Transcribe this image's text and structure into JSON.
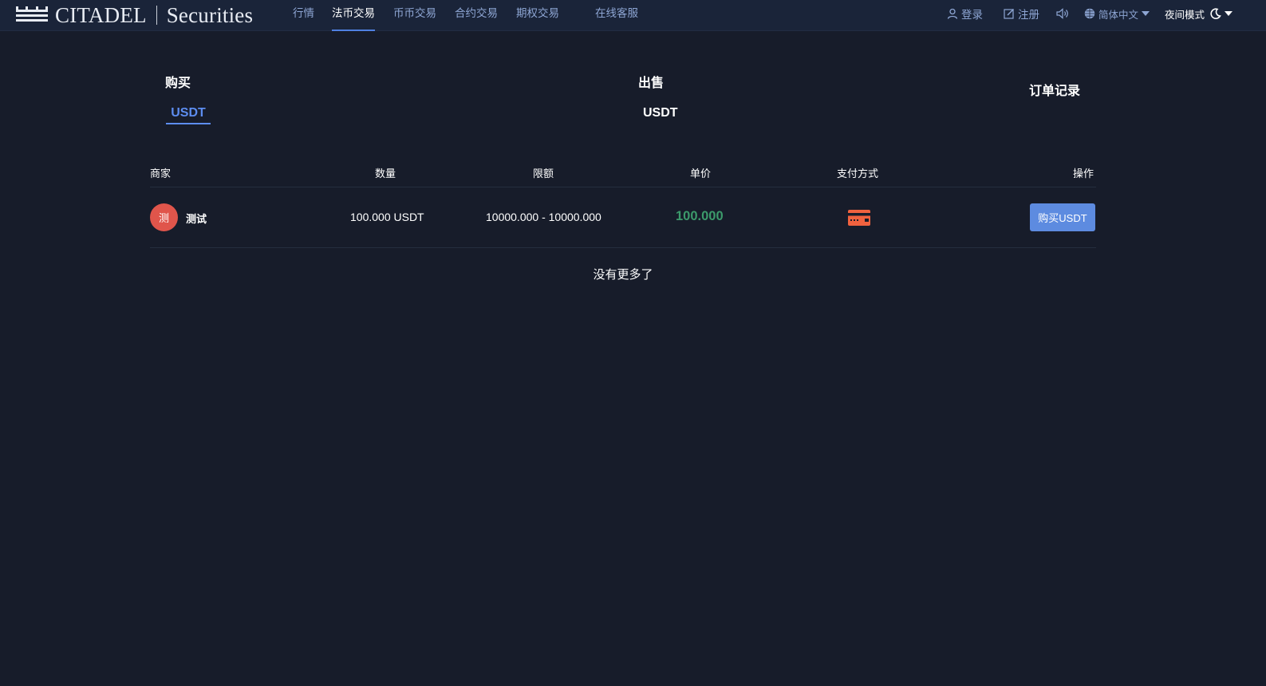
{
  "header": {
    "logo": {
      "brand": "CITADEL",
      "suffix": "Securities"
    },
    "nav": [
      {
        "label": "行情"
      },
      {
        "label": "法币交易"
      },
      {
        "label": "币币交易"
      },
      {
        "label": "合约交易"
      },
      {
        "label": "期权交易"
      },
      {
        "label": "在线客服"
      }
    ],
    "active_nav": "法币交易",
    "login": "登录",
    "register": "注册",
    "language": "简体中文",
    "night_mode": "夜间模式",
    "icons": [
      "user-icon",
      "edit-icon",
      "speaker-icon",
      "globe-icon",
      "moon-icon"
    ]
  },
  "otc": {
    "buy_label": "购买",
    "sell_label": "出售",
    "order_record": "订单记录",
    "buy_coin": "USDT",
    "sell_coin": "USDT",
    "columns": {
      "merchant": "商家",
      "quantity": "数量",
      "limit": "限额",
      "price": "单价",
      "payment": "支付方式",
      "action": "操作"
    },
    "rows": [
      {
        "avatar_char": "测",
        "merchant": "测试",
        "quantity": "100.000 USDT",
        "limit": "10000.000 - 10000.000",
        "price": "100.000",
        "payment_icon": "bank-card-icon",
        "action": "购买USDT"
      }
    ],
    "no_more": "没有更多了"
  },
  "colors": {
    "background": "#171c2a",
    "header": "#1a2439",
    "accent": "#5d8df0",
    "price_green": "#3c9a6b",
    "avatar_red": "#e0554b",
    "card_orange": "#f0623f"
  }
}
